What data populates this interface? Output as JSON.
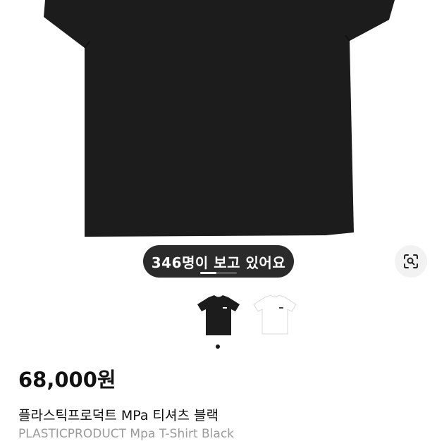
{
  "product": {
    "viewers_text": "346명이 보고 있어요",
    "price": "68,000원",
    "title_ko": "플라스틱프로덕트 MPa 티셔츠 블랙",
    "title_en": "PLASTICPRODUCT Mpa T-Shirt Black"
  },
  "gallery": {
    "image_count": 2,
    "selected_index": 0,
    "variants": [
      "black",
      "white"
    ],
    "carousel_progress": 0.45
  },
  "icons": {
    "lens": "lens-search-icon"
  },
  "colors": {
    "shirt_black": "#1c1c1c",
    "badge_bg": "#2b2b2b",
    "text_primary": "#111111",
    "text_secondary": "#9a9a9a"
  }
}
